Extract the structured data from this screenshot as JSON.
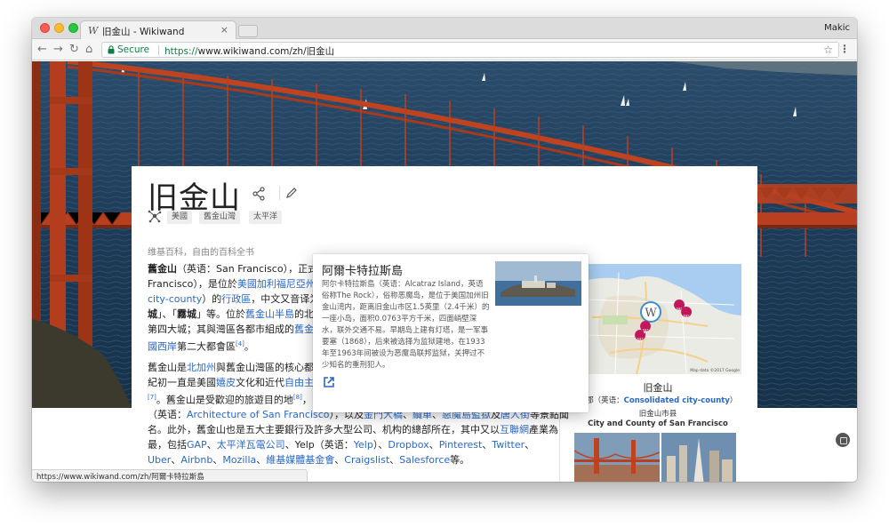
{
  "colors": {
    "link": "#2a68c8",
    "secure": "#0b8043",
    "marker": "#c2185b",
    "bridge": "#c0431f",
    "water": "#1e3e5a"
  },
  "browser": {
    "tab_title": "旧金山 - Wikiwand",
    "tab_favicon": "W",
    "tab_close": "×",
    "profile_name": "Makic",
    "secure_label": "Secure",
    "url_scheme": "https://",
    "url_rest": "www.wikiwand.com/zh/旧金山",
    "icons": [
      "back-icon",
      "forward-icon",
      "reload-icon",
      "home-icon",
      "lock-icon",
      "star-icon",
      "menu-icon"
    ],
    "nav": {
      "back": "←",
      "forward": "→",
      "reload": "↻",
      "home": "⌂"
    },
    "star": "☆",
    "menu": "⋮"
  },
  "article": {
    "title": "旧金山",
    "tags": [
      "美國",
      "舊金山灣",
      "太平洋"
    ],
    "from_text": "维基百科，自由的百科全书",
    "para1": [
      [
        {
          "t": "舊金山",
          "b": true
        },
        {
          "t": "（英语：San Francisco），正式"
        }
      ],
      [
        {
          "t": "Francisco），是位於"
        },
        {
          "t": "美國加利福尼亞州",
          "l": true
        }
      ],
      [
        {
          "t": "city-county",
          "l": true
        },
        {
          "t": "）的"
        },
        {
          "t": "行政區",
          "l": true
        },
        {
          "t": "，中文又音译为"
        },
        {
          "t": "三",
          "l": true
        }
      ],
      [
        {
          "t": "城",
          "b": true
        },
        {
          "t": "」、「"
        },
        {
          "t": "霧城",
          "b": true
        },
        {
          "t": "」等。位於"
        },
        {
          "t": "舊金山半島",
          "l": true
        },
        {
          "t": "的北"
        }
      ],
      [
        {
          "t": "第四大城；其與灣區各都市組成的"
        },
        {
          "t": "舊金",
          "l": true
        }
      ],
      [
        {
          "t": "國西岸",
          "l": true
        },
        {
          "t": "第二大都會區"
        },
        {
          "t": "[4]",
          "s": true
        },
        {
          "t": "。"
        }
      ]
    ],
    "para2": [
      [
        {
          "t": "舊金山是"
        },
        {
          "t": "北加州",
          "l": true
        },
        {
          "t": "與舊金山灣區的核心都市"
        }
      ],
      [
        {
          "t": "紀初一直是美國"
        },
        {
          "t": "嬉皮",
          "l": true
        },
        {
          "t": "文化和近代"
        },
        {
          "t": "自由主義",
          "l": true
        }
      ],
      [
        {
          "t": "[7]",
          "s": true
        },
        {
          "t": "。舊金山是受歡迎的旅遊目的地"
        },
        {
          "t": "[8]",
          "s": true
        },
        {
          "t": "，以其涼爽的夏季、多霧、綿延的丘陵地形、混合的建築風格"
        }
      ],
      [
        {
          "t": "（英语："
        },
        {
          "t": "Architecture of San Francisco",
          "l": true
        },
        {
          "t": "），以及"
        },
        {
          "t": "金門大橋",
          "l": true
        },
        {
          "t": "、"
        },
        {
          "t": "纜車",
          "l": true
        },
        {
          "t": "、"
        },
        {
          "t": "惡魔島監獄",
          "l": true
        },
        {
          "t": "及"
        },
        {
          "t": "唐人街",
          "l": true
        },
        {
          "t": "等景點聞"
        }
      ],
      [
        {
          "t": "名。此外，舊金山也是五大主要銀行及許多大型公司、机构的總部所在，其中又以"
        },
        {
          "t": "互聯網",
          "l": true
        },
        {
          "t": "產業為"
        }
      ],
      [
        {
          "t": "最，包括"
        },
        {
          "t": "GAP",
          "l": true
        },
        {
          "t": "、"
        },
        {
          "t": "太平洋瓦電公司",
          "l": true
        },
        {
          "t": "、Yelp（英语："
        },
        {
          "t": "Yelp",
          "l": true
        },
        {
          "t": "）、"
        },
        {
          "t": "Dropbox",
          "l": true
        },
        {
          "t": "、"
        },
        {
          "t": "Pinterest",
          "l": true
        },
        {
          "t": "、"
        },
        {
          "t": "Twitter",
          "l": true
        },
        {
          "t": "、"
        }
      ],
      [
        {
          "t": "Uber",
          "l": true
        },
        {
          "t": "、"
        },
        {
          "t": "Airbnb",
          "l": true
        },
        {
          "t": "、"
        },
        {
          "t": "Mozilla",
          "l": true
        },
        {
          "t": "、"
        },
        {
          "t": "維基媒體基金會",
          "l": true
        },
        {
          "t": "、"
        },
        {
          "t": "Craigslist",
          "l": true
        },
        {
          "t": "、"
        },
        {
          "t": "Salesforce",
          "l": true
        },
        {
          "t": "等。"
        }
      ]
    ]
  },
  "infobox": {
    "title": "旧金山",
    "line1_prefix": "市郡（英语：",
    "line1_link": "Consolidated city-county",
    "line1_suffix": "）",
    "line2": "旧金山市县",
    "line3": "City and County of San Francisco",
    "map_credit": "Map data ©2017 Google"
  },
  "popup": {
    "title": "阿爾卡特拉斯島",
    "body": "阿尔卡特拉斯島（英语：Alcatraz Island，英语俗称The Rock），俗称恶魔岛，是位于美国加州旧金山湾内，距离旧金山市区1.5英里（2.4千米）的一座小岛，面积0.0763平方千米，四面峭壁深水，联外交通不易。早期岛上建有灯塔，是一军事要塞（1868），后来被选择为监狱建地，在1933年至1963年间被设为恶魔岛联邦监狱，关押过不少知名的重刑犯人。"
  },
  "status_url": "https://www.wikiwand.com/zh/阿爾卡特拉斯島"
}
